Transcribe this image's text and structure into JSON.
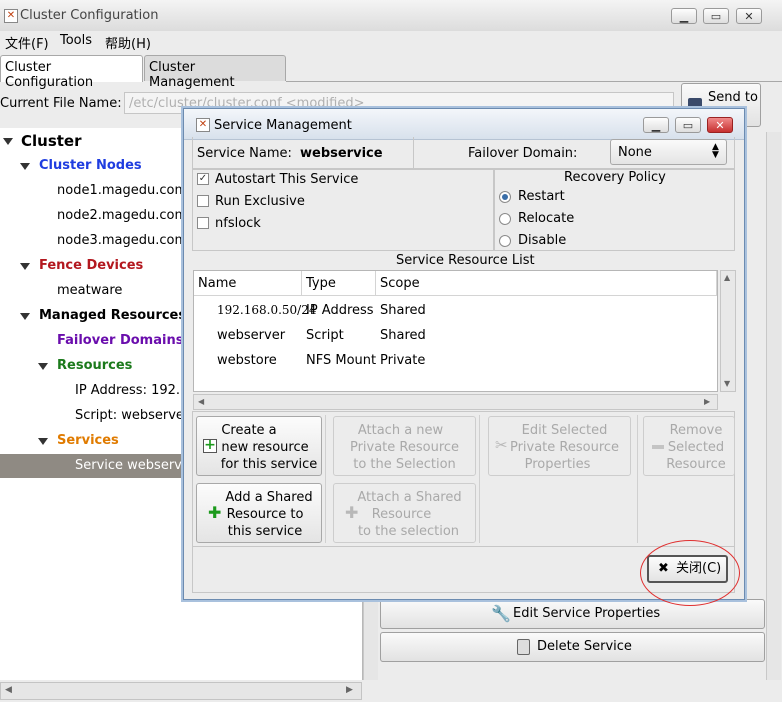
{
  "window": {
    "title": "Cluster Configuration"
  },
  "menu": [
    "文件(F)",
    "Tools",
    "帮助(H)"
  ],
  "tabs": [
    "Cluster Configuration",
    "Cluster Management"
  ],
  "file": {
    "label": "Current File Name:",
    "value": "/etc/cluster/cluster.conf <modified>"
  },
  "send_button": {
    "line1": "Send to",
    "line2": "er"
  },
  "tree": {
    "cluster": "Cluster",
    "cluster_nodes": "Cluster Nodes",
    "nodes": [
      "node1.magedu.com",
      "node2.magedu.com",
      "node3.magedu.com"
    ],
    "fence_devices": "Fence Devices",
    "fence_items": [
      "meatware"
    ],
    "managed_resources": "Managed Resources",
    "failover_domains": "Failover Domains",
    "resources": "Resources",
    "resource_items": [
      "IP Address:  192.1",
      "Script:  webserve"
    ],
    "services": "Services",
    "service_items": [
      "Service webserv"
    ]
  },
  "main_buttons": {
    "edit_service": "Edit Service Properties",
    "delete_service": "Delete Service"
  },
  "dialog": {
    "title": "Service Management",
    "service_name_label": "Service Name:",
    "service_name": "webservice",
    "failover_label": "Failover Domain:",
    "failover_value": "None",
    "checkboxes": [
      {
        "label": "Autostart This Service",
        "checked": true
      },
      {
        "label": "Run Exclusive",
        "checked": false
      },
      {
        "label": "nfslock",
        "checked": false
      }
    ],
    "recovery": {
      "title": "Recovery Policy",
      "options": [
        "Restart",
        "Relocate",
        "Disable"
      ],
      "selected": "Restart"
    },
    "resource_list": {
      "title": "Service Resource List",
      "columns": [
        "Name",
        "Type",
        "Scope"
      ],
      "rows": [
        [
          "192.168.0.50/24",
          "IP Address",
          "Shared"
        ],
        [
          "webserver",
          "Script",
          "Shared"
        ],
        [
          "webstore",
          "NFS Mount",
          "Private"
        ]
      ]
    },
    "buttons": {
      "create_new": [
        "Create a",
        "new resource",
        "for this service"
      ],
      "add_shared": [
        "Add a Shared",
        "Resource to",
        "this service"
      ],
      "attach_new": [
        "Attach a new",
        "Private Resource",
        "to the Selection"
      ],
      "attach_shared": [
        "Attach a Shared",
        "Resource",
        "to the selection"
      ],
      "edit_selected": [
        "Edit Selected",
        "Private Resource",
        "Properties"
      ],
      "remove_selected": [
        "Remove",
        "Selected",
        "Resource"
      ],
      "close": "关闭(C)"
    }
  },
  "colors": {
    "node_blue": "#1f3de0",
    "fence_red": "#b3181f",
    "purple": "#6a0dad",
    "green": "#1c7a1c",
    "orange": "#e07b00",
    "selection": "#8f8a83",
    "annotation": "#e03030"
  }
}
